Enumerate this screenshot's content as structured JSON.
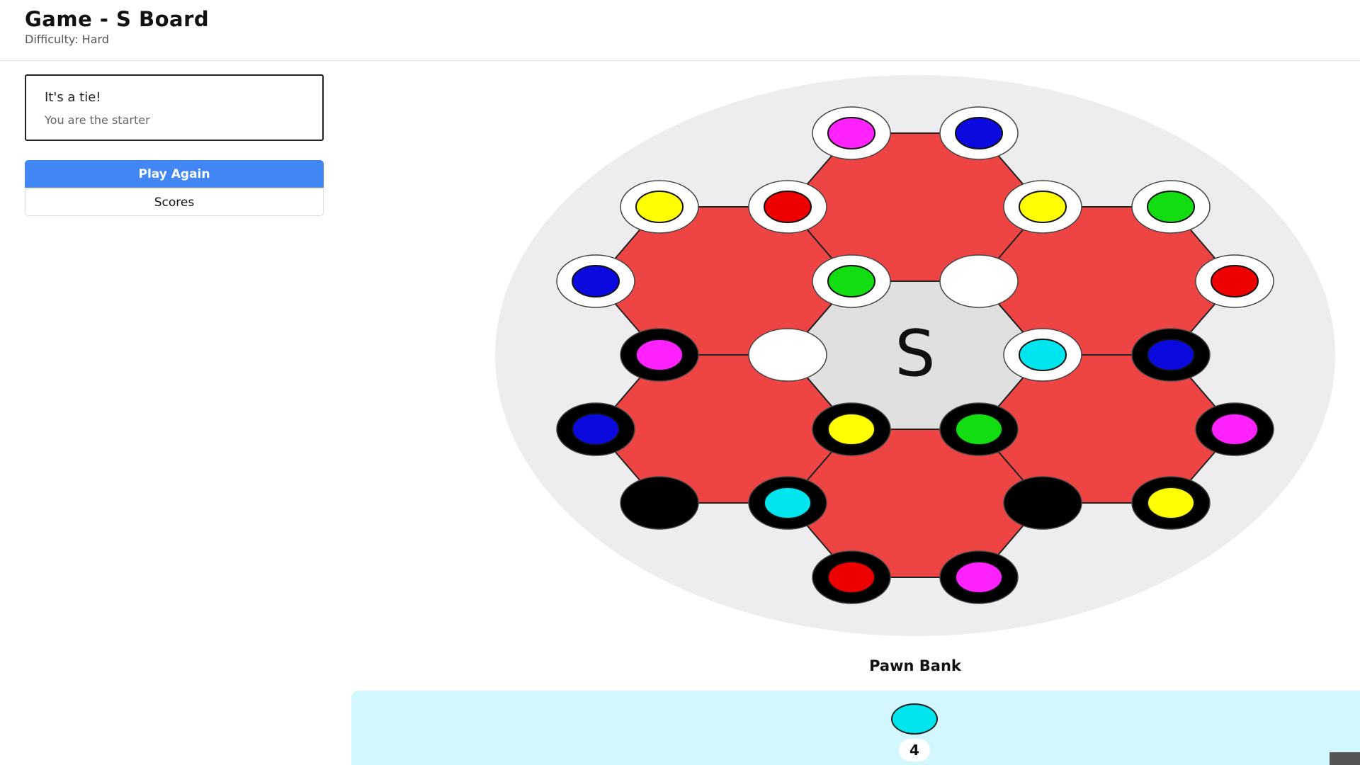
{
  "header": {
    "title": "Game - S Board",
    "difficulty": "Difficulty: Hard"
  },
  "status": {
    "title": "It's a tie!",
    "subtitle": "You are the starter"
  },
  "buttons": {
    "play_again": "Play Again",
    "scores": "Scores"
  },
  "board": {
    "center_letter": "S",
    "colors": {
      "hex_fill": "#ef4444",
      "center_fill": "#e0e0e0",
      "disc_background": "#ededf0",
      "white_owner": "#ffffff",
      "black_owner": "#000000",
      "magenta": "#ff22ff",
      "blue": "#0a0adf",
      "yellow": "#ffff00",
      "red": "#ee0000",
      "green": "#11dd11",
      "cyan": "#00e5ee"
    },
    "nodes": [
      {
        "id": "n1",
        "owner": "white",
        "pawn": "magenta"
      },
      {
        "id": "n2",
        "owner": "white",
        "pawn": "blue"
      },
      {
        "id": "n3",
        "owner": "white",
        "pawn": "yellow"
      },
      {
        "id": "n4",
        "owner": "white",
        "pawn": "red"
      },
      {
        "id": "n5",
        "owner": "white",
        "pawn": "yellow"
      },
      {
        "id": "n6",
        "owner": "white",
        "pawn": "green"
      },
      {
        "id": "n7",
        "owner": "white",
        "pawn": "blue"
      },
      {
        "id": "n8",
        "owner": "white",
        "pawn": "green"
      },
      {
        "id": "n9",
        "owner": "white",
        "pawn": null
      },
      {
        "id": "n10",
        "owner": "white",
        "pawn": "red"
      },
      {
        "id": "n11",
        "owner": "black",
        "pawn": "magenta"
      },
      {
        "id": "n12",
        "owner": "white",
        "pawn": null
      },
      {
        "id": "n13",
        "owner": "white",
        "pawn": "cyan"
      },
      {
        "id": "n14",
        "owner": "black",
        "pawn": "blue"
      },
      {
        "id": "n15",
        "owner": "black",
        "pawn": "blue"
      },
      {
        "id": "n16",
        "owner": "black",
        "pawn": "yellow"
      },
      {
        "id": "n17",
        "owner": "black",
        "pawn": "green"
      },
      {
        "id": "n18",
        "owner": "black",
        "pawn": "magenta"
      },
      {
        "id": "n19",
        "owner": "black",
        "pawn": null
      },
      {
        "id": "n20",
        "owner": "black",
        "pawn": "cyan"
      },
      {
        "id": "n21",
        "owner": "black",
        "pawn": null
      },
      {
        "id": "n22",
        "owner": "black",
        "pawn": "yellow"
      },
      {
        "id": "n23",
        "owner": "black",
        "pawn": "red"
      },
      {
        "id": "n24",
        "owner": "black",
        "pawn": "magenta"
      }
    ]
  },
  "pawn_bank": {
    "label": "Pawn Bank",
    "pawn_color": "cyan",
    "count": "4"
  }
}
